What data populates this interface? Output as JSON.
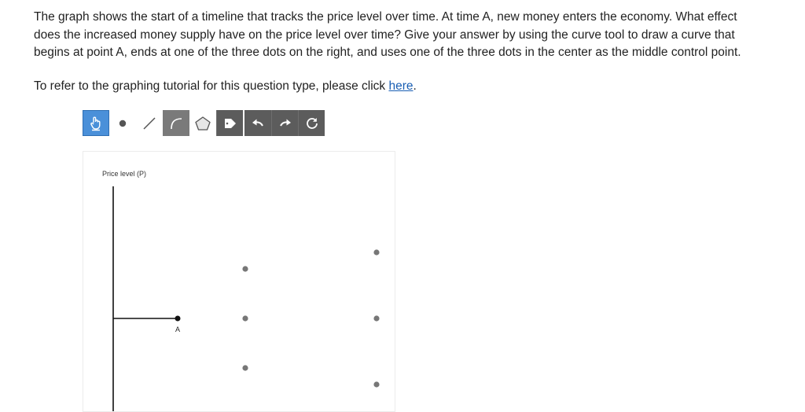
{
  "question": {
    "text": "The graph shows the start of a timeline that tracks the price level over time. At time A, new money enters the economy. What effect does the increased money supply have on the price level over time? Give your answer by using the curve tool to draw a curve that begins at point A, ends at one of the three dots on the right, and uses one of the three dots in the center as the middle control point."
  },
  "tutorial": {
    "prefix": "To refer to the graphing tutorial for this question type, please click ",
    "link": "here",
    "suffix": "."
  },
  "toolbar": {
    "tools": [
      {
        "name": "hand-tool",
        "icon": "hand-icon"
      },
      {
        "name": "point-tool",
        "icon": "dot-icon"
      },
      {
        "name": "line-tool",
        "icon": "line-icon"
      },
      {
        "name": "curve-tool",
        "icon": "curve-icon"
      },
      {
        "name": "polygon-tool",
        "icon": "pentagon-icon"
      },
      {
        "name": "label-tool",
        "icon": "tag-icon"
      },
      {
        "name": "undo-button",
        "icon": "undo-arrow-icon"
      },
      {
        "name": "redo-button",
        "icon": "redo-arrow-icon"
      },
      {
        "name": "reset-button",
        "icon": "reset-icon"
      }
    ],
    "colors": {
      "hand": "#4a90d9",
      "dark": "#5c5c5c",
      "selected": "#7a7a7a"
    }
  },
  "graph": {
    "ylabel": "Price level (P)",
    "pointA": "A"
  }
}
